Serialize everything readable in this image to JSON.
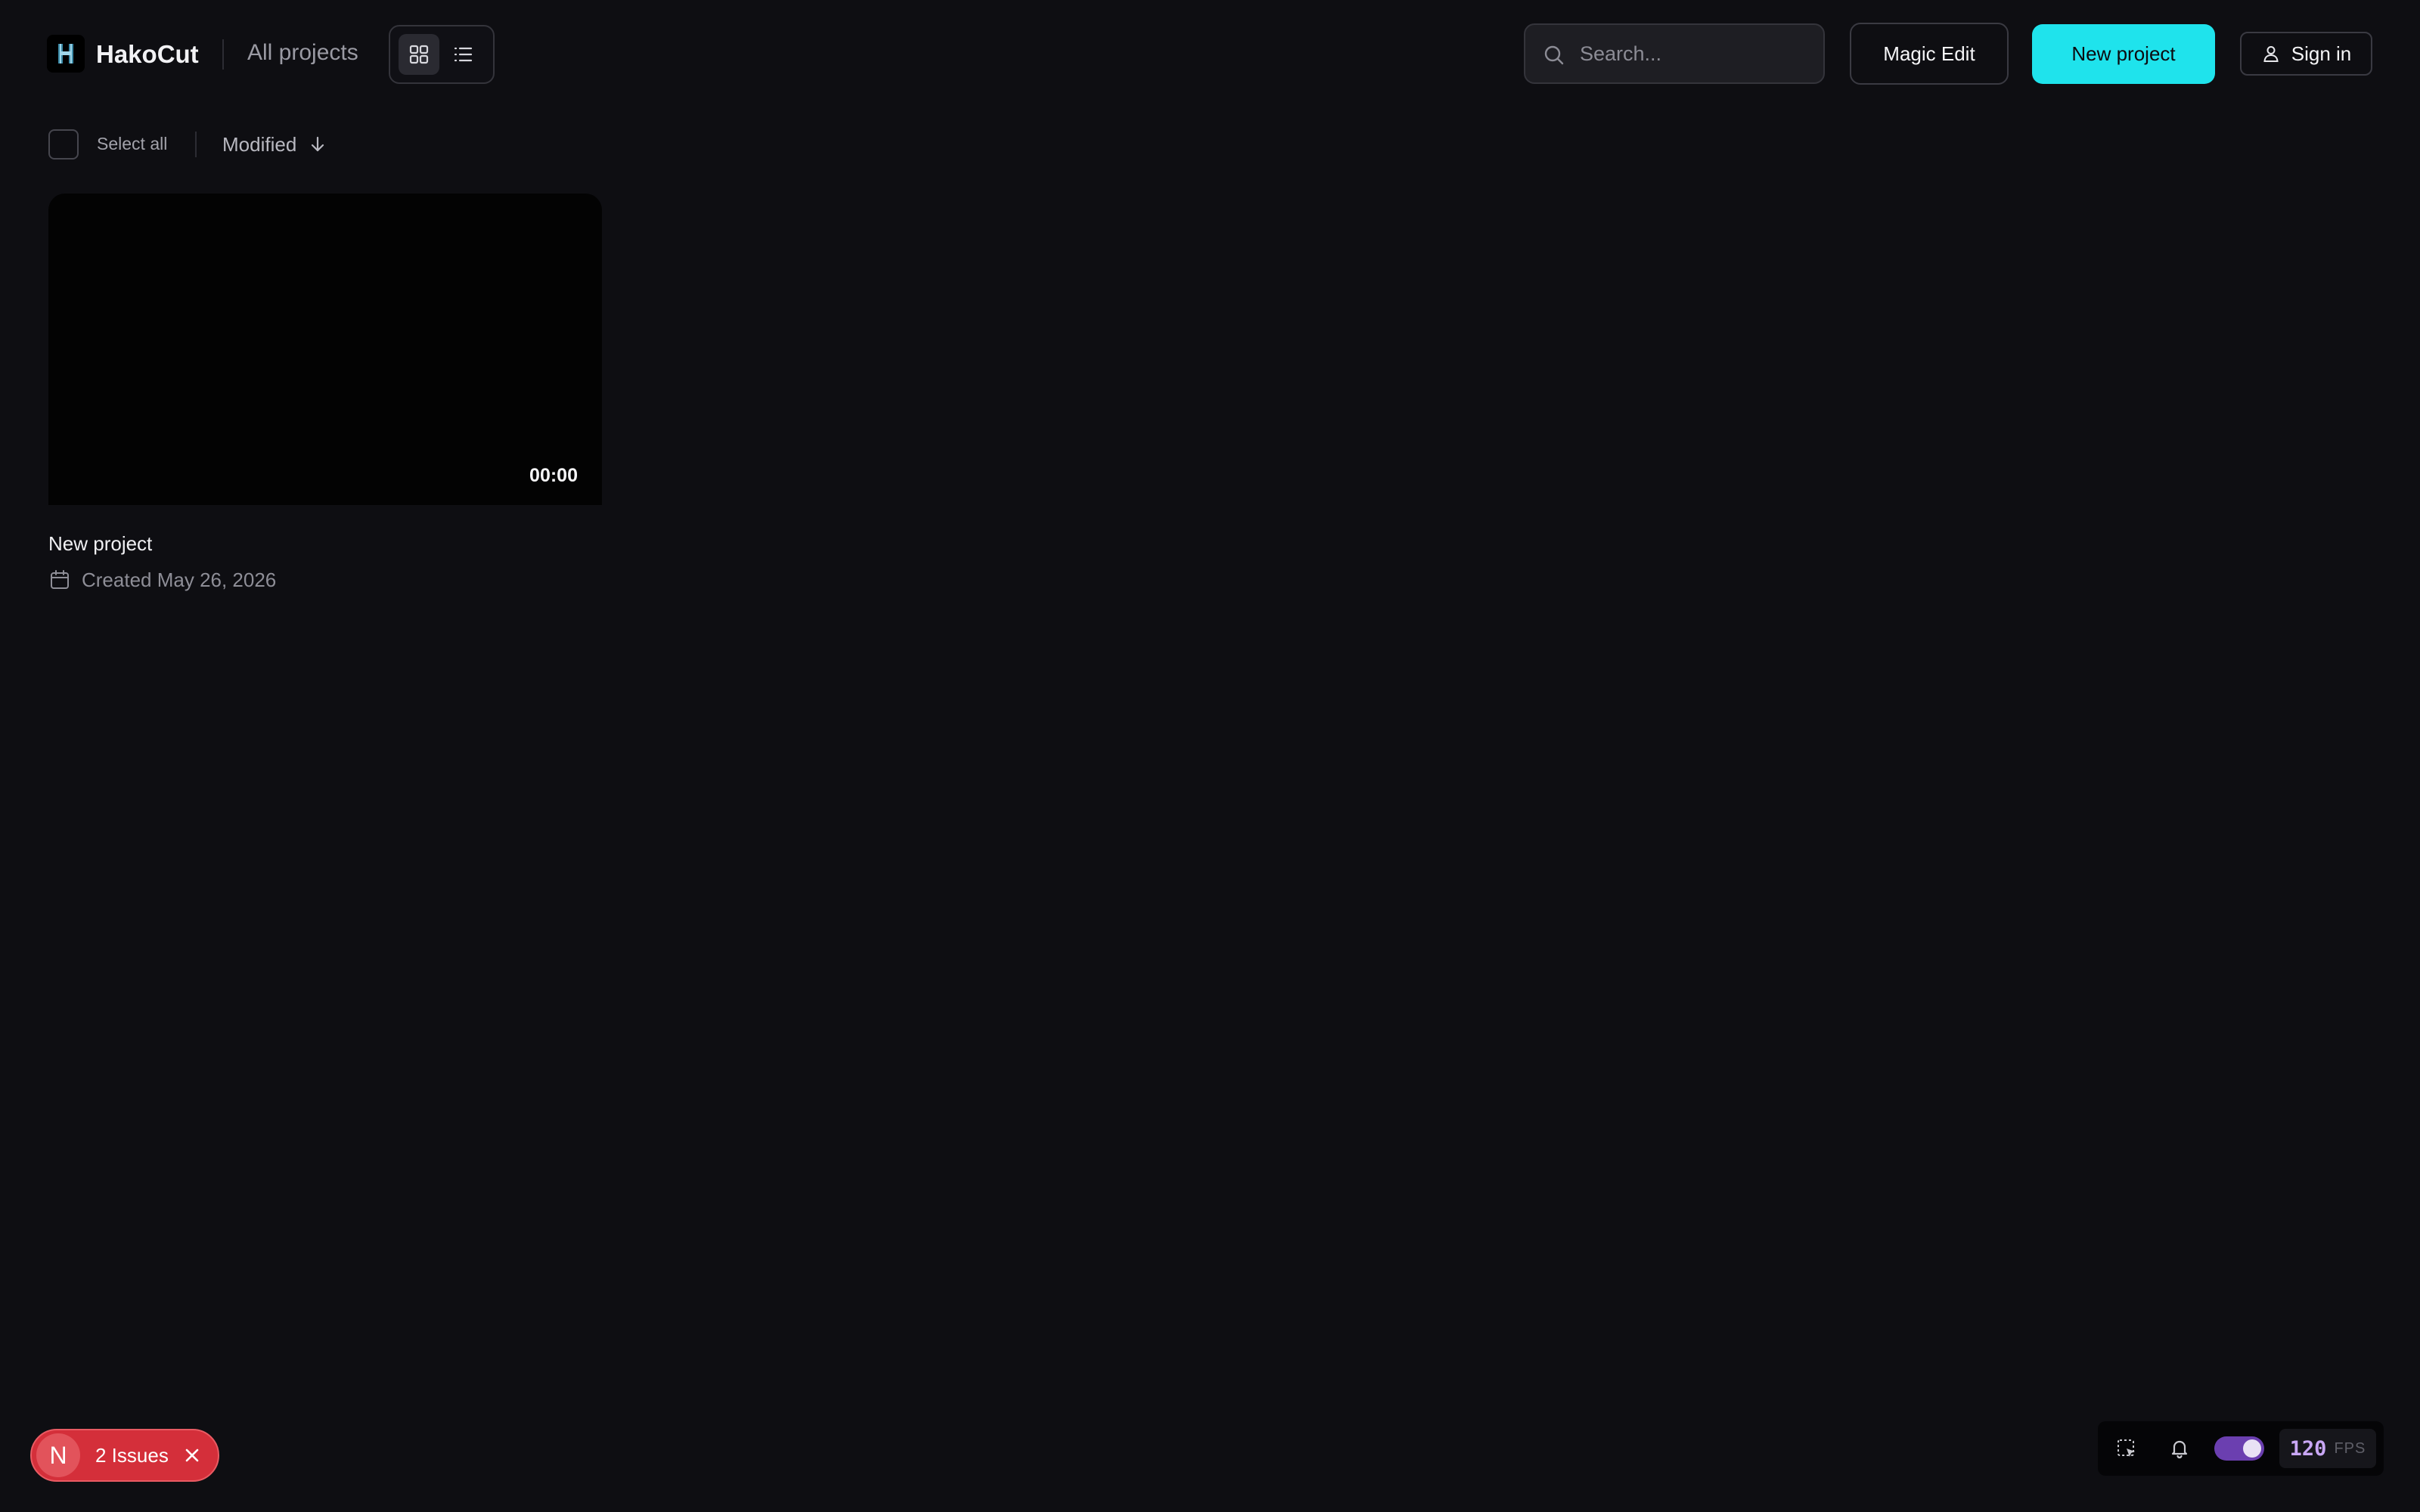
{
  "app": {
    "name": "HakoCut",
    "breadcrumb": "All projects",
    "logo_icon": "hakocut-logo-icon"
  },
  "header": {
    "search_placeholder": "Search...",
    "magic_edit_label": "Magic Edit",
    "new_project_label": "New project",
    "sign_in_label": "Sign in",
    "view_modes": [
      "grid",
      "list"
    ],
    "active_view": "grid"
  },
  "toolbar": {
    "select_all_label": "Select all",
    "sort_label": "Modified",
    "sort_direction": "descending"
  },
  "projects": [
    {
      "title": "New project",
      "duration": "00:00",
      "created": "Created May 26, 2026"
    }
  ],
  "issues_badge": {
    "avatar_letter": "N",
    "label": "2 Issues"
  },
  "dev_toolbar": {
    "fps_value": "120",
    "fps_unit": "FPS",
    "toggle_on": true
  },
  "colors": {
    "background": "#0e0e12",
    "accent": "#1fe3ec",
    "issues_red": "#d42f3a",
    "toggle_purple": "#6b3fb0",
    "fps_purple": "#c9a7f5"
  }
}
